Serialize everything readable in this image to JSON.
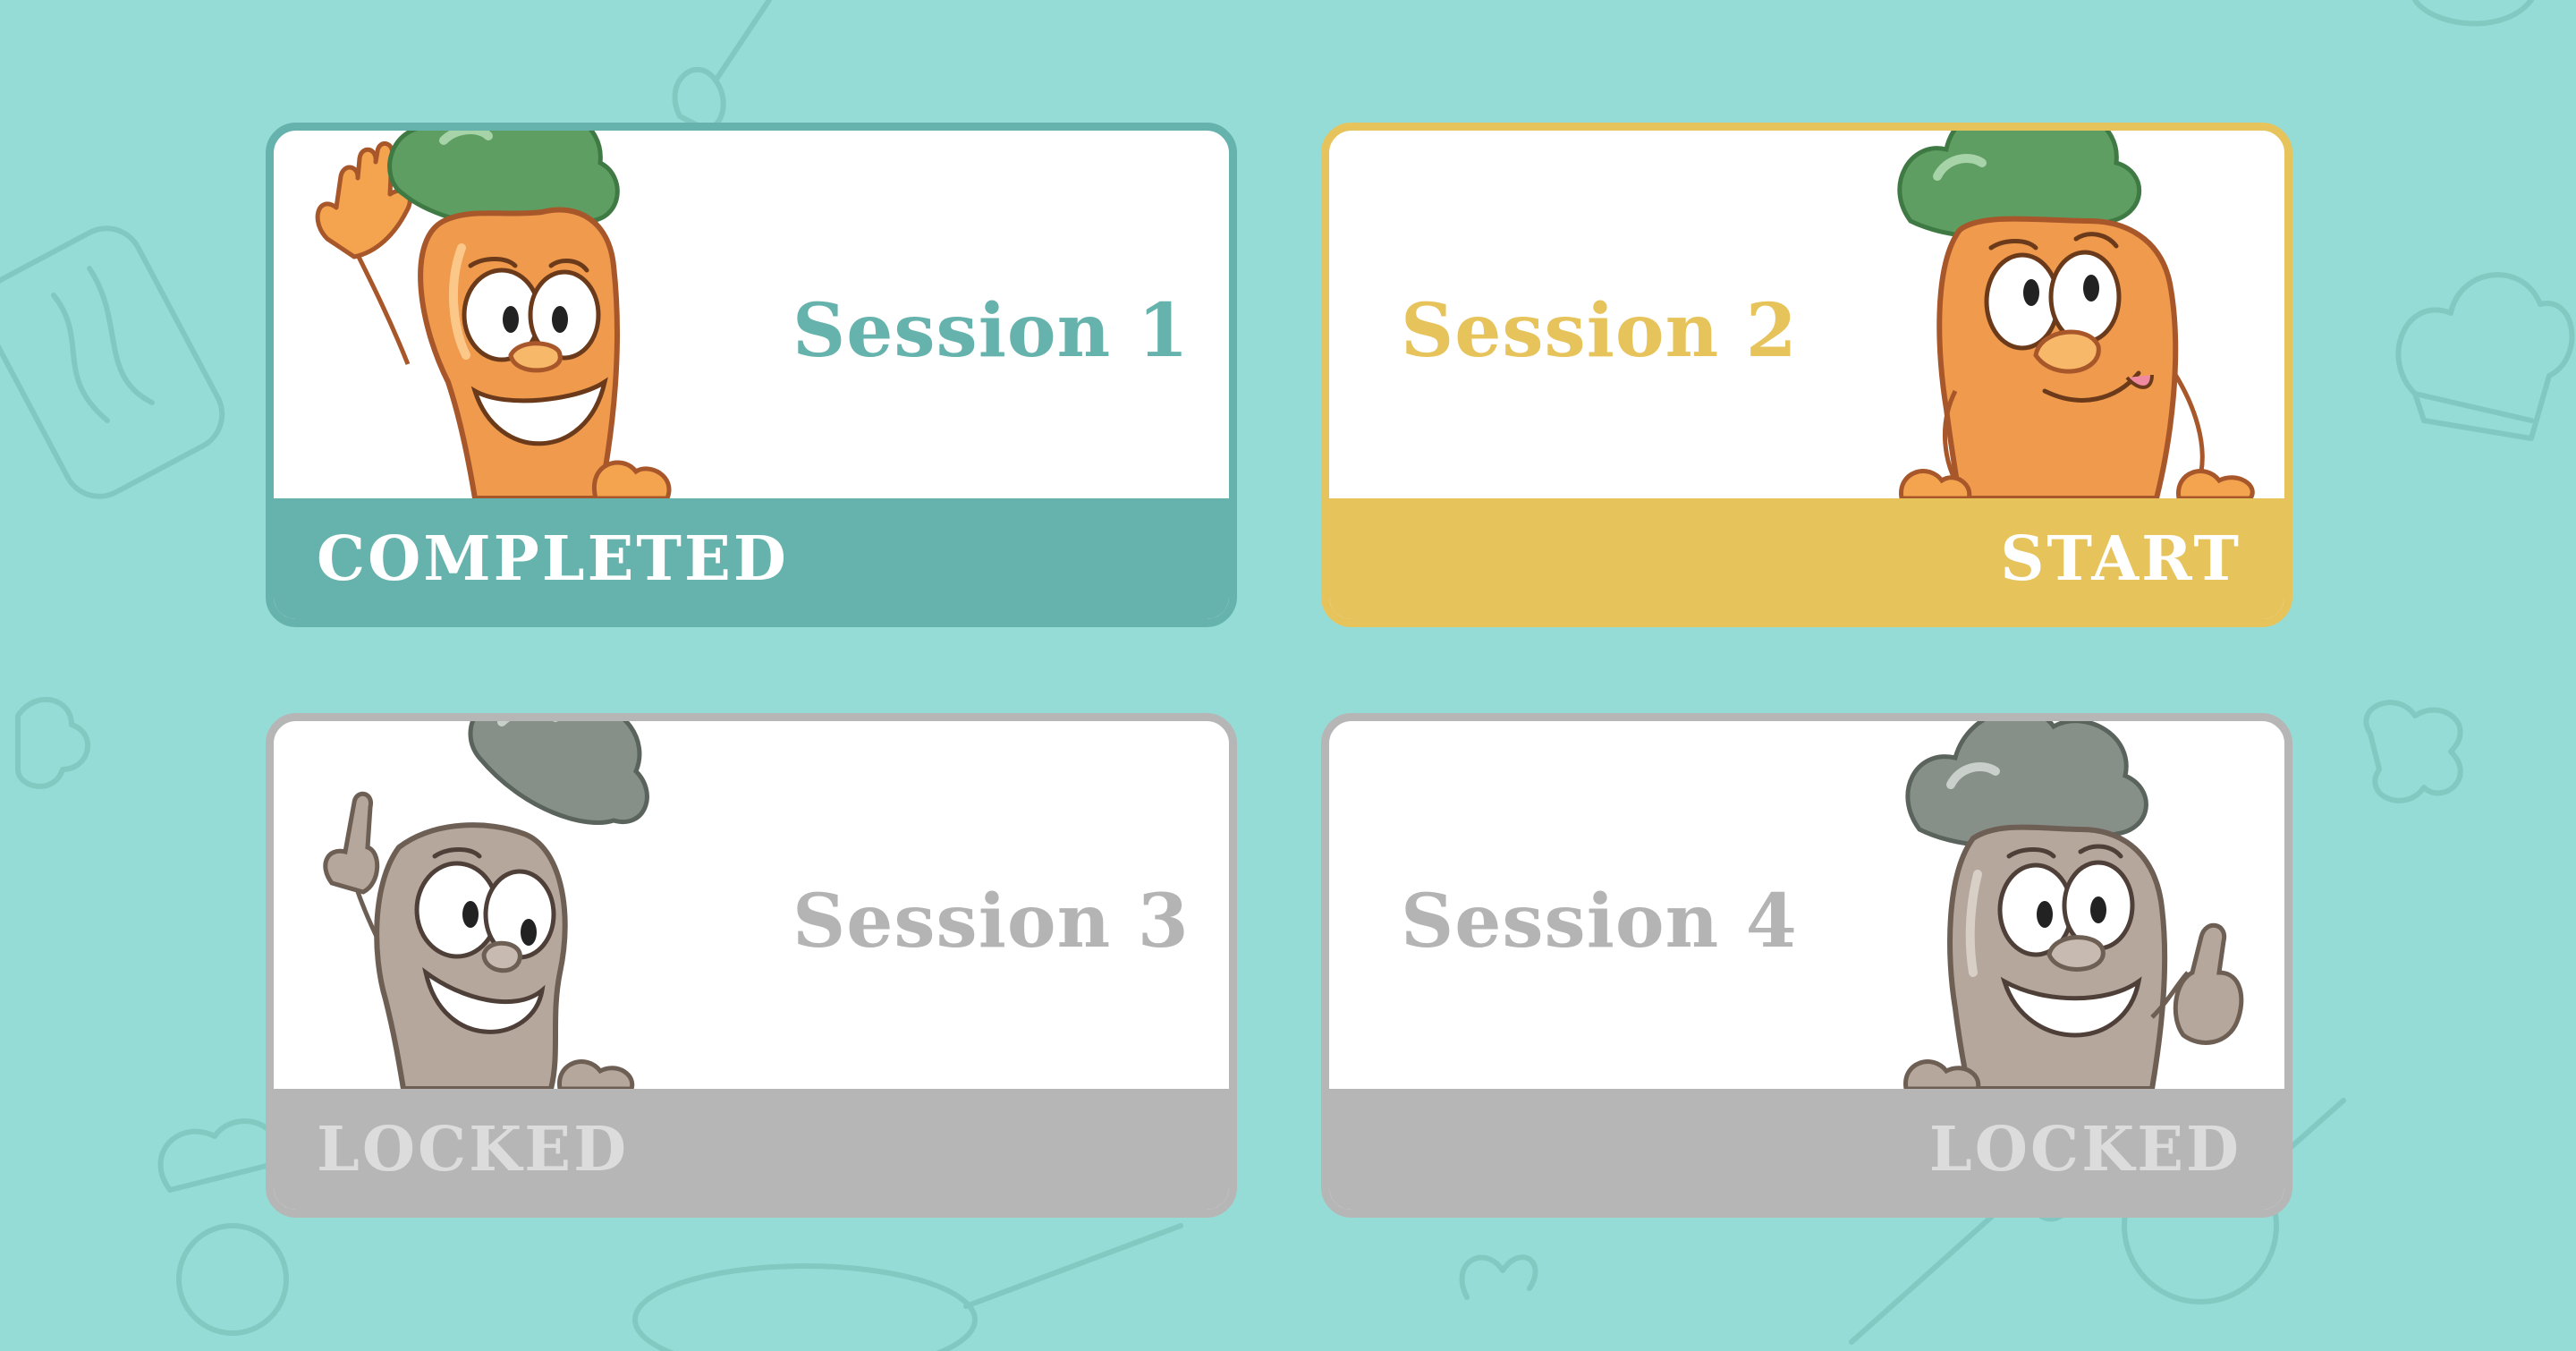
{
  "colors": {
    "background": "#96dcd6",
    "completed": "#66b3ad",
    "start": "#e7c35c",
    "locked": "#b6b6b6",
    "carrot": "#ef9a4d",
    "leaf": "#5c9e62",
    "locked_body": "#b5a79b",
    "locked_leaf": "#869189"
  },
  "sessions": [
    {
      "title": "Session 1",
      "status": "COMPLETED",
      "state": "completed",
      "mascot_icon": "carrot-waving-icon"
    },
    {
      "title": "Session 2",
      "status": "START",
      "state": "start",
      "mascot_icon": "carrot-thinking-icon"
    },
    {
      "title": "Session 3",
      "status": "LOCKED",
      "state": "locked",
      "mascot_icon": "carrot-pointing-icon"
    },
    {
      "title": "Session 4",
      "status": "LOCKED",
      "state": "locked",
      "mascot_icon": "carrot-thumbs-up-icon"
    }
  ]
}
